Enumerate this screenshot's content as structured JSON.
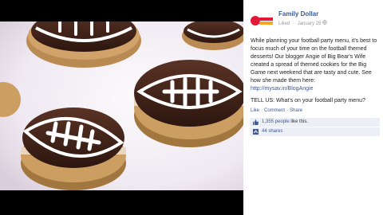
{
  "post": {
    "page_name": "Family Dollar",
    "status": "Liked",
    "date": "January 25",
    "paragraph": "While planning your football party menu, it's best to focus much of your time on the football themed desserts! Our blogger Angie of Big Bear's Wife created a spread of themed cookies for the Big Game next weekend that are tasty and cute. See how she made them here:",
    "link": "http://mysav.in/BlogAngie",
    "question": "TELL US: What's on your football party menu?"
  },
  "actions": {
    "like": "Like",
    "comment": "Comment",
    "share": "Share"
  },
  "engagement": {
    "likes_count": "1,355 people",
    "likes_suffix": " like this.",
    "shares": "44 shares"
  },
  "colors": {
    "link_blue": "#3b5998",
    "logo_red": "#e31837",
    "panel_bg": "#eceff5"
  },
  "icons": {
    "logo": "family-dollar-logo",
    "privacy": "globe-icon",
    "like": "thumbs-up-icon",
    "share": "share-icon"
  }
}
